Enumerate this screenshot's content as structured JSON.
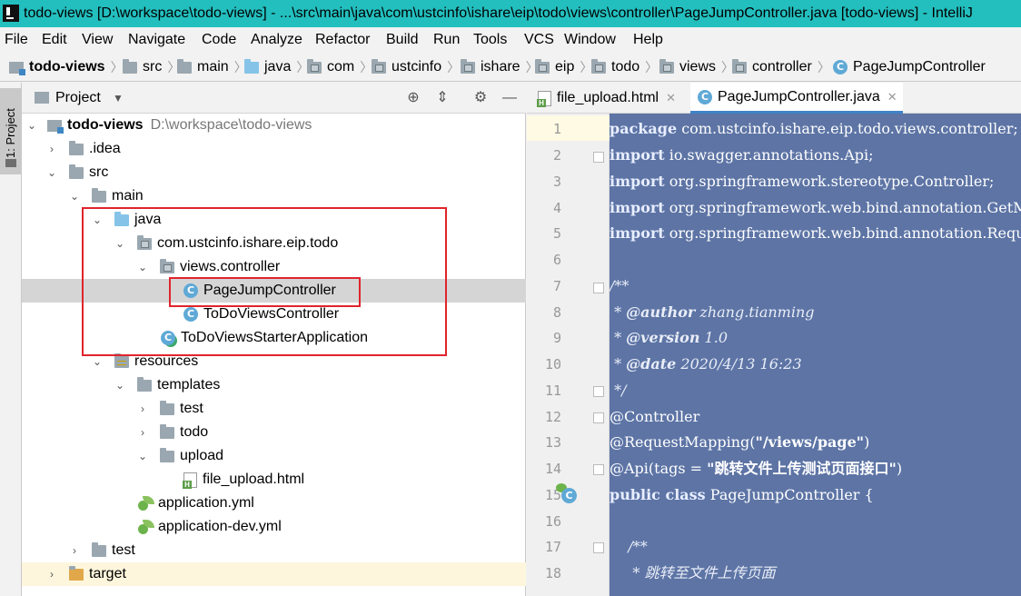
{
  "window": {
    "title": "todo-views [D:\\workspace\\todo-views] - ...\\src\\main\\java\\com\\ustcinfo\\ishare\\eip\\todo\\views\\controller\\PageJumpController.java [todo-views] - IntelliJ"
  },
  "menu": [
    "File",
    "Edit",
    "View",
    "Navigate",
    "Code",
    "Analyze",
    "Refactor",
    "Build",
    "Run",
    "Tools",
    "VCS",
    "Window",
    "Help"
  ],
  "breadcrumb": [
    "todo-views",
    "src",
    "main",
    "java",
    "com",
    "ustcinfo",
    "ishare",
    "eip",
    "todo",
    "views",
    "controller",
    "PageJumpController"
  ],
  "tool_stripe": {
    "project_tab": "1: Project"
  },
  "project_panel": {
    "title": "Project",
    "tree": {
      "root_name": "todo-views",
      "root_path": "D:\\workspace\\todo-views",
      "idea": ".idea",
      "src": "src",
      "main": "main",
      "java": "java",
      "package": "com.ustcinfo.ishare.eip.todo",
      "views_controller": "views.controller",
      "page_jump": "PageJumpController",
      "todo_views_controller": "ToDoViewsController",
      "starter_app": "ToDoViewsStarterApplication",
      "resources": "resources",
      "templates": "templates",
      "test_tpl": "test",
      "todo_tpl": "todo",
      "upload": "upload",
      "file_upload": "file_upload.html",
      "app_yml": "application.yml",
      "app_dev_yml": "application-dev.yml",
      "test": "test",
      "target": "target"
    }
  },
  "editor": {
    "tabs": [
      "file_upload.html",
      "PageJumpController.java"
    ],
    "line_numbers": [
      "1",
      "2",
      "3",
      "4",
      "5",
      "6",
      "7",
      "8",
      "9",
      "10",
      "11",
      "12",
      "13",
      "14",
      "15",
      "16",
      "17",
      "18"
    ],
    "code": {
      "l1_kw": "package",
      "l1_rest": " com.ustcinfo.ishare.eip.todo.views.controller;",
      "l2_kw": "import",
      "l2_rest": " io.swagger.annotations.Api;",
      "l3_kw": "import",
      "l3_rest": " org.springframework.stereotype.Controller;",
      "l4_kw": "import",
      "l4_rest": " org.springframework.web.bind.annotation.GetMapping;",
      "l5_kw": "import",
      "l5_rest": " org.springframework.web.bind.annotation.RequestMapping;",
      "l7": "/**",
      "l8_pre": " * ",
      "l8_tag": "@author",
      "l8_rest": " zhang.tianming",
      "l9_pre": " * ",
      "l9_tag": "@version",
      "l9_rest": " 1.0",
      "l10_pre": " * ",
      "l10_tag": "@date",
      "l10_rest": " 2020/4/13 16:23",
      "l11": " */",
      "l12": "@Controller",
      "l13_pre": "@RequestMapping(",
      "l13_str": "\"/views/page\"",
      "l13_post": ")",
      "l14_pre": "@Api(tags = ",
      "l14_str": "\"跳转文件上传测试页面接口\"",
      "l14_post": ")",
      "l15_kw": "public class",
      "l15_rest": " PageJumpController {",
      "l17": "    /**",
      "l18": "     * 跳转至文件上传页面"
    }
  },
  "colors": {
    "title_bar": "#23bfbf",
    "selection": "#5d74a5",
    "highlight_box": "#e0242c"
  }
}
